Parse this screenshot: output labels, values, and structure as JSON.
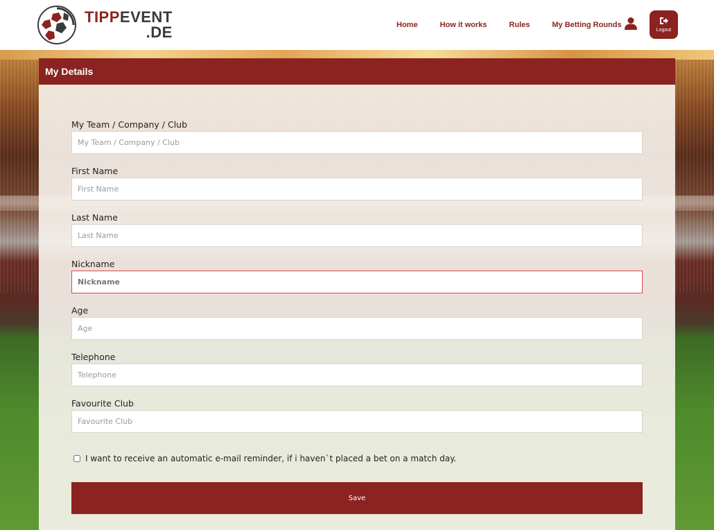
{
  "brand": {
    "logo_part1": "TIPP",
    "logo_part2": "EVENT",
    "logo_line2": ".DE",
    "primary_color": "#8b2320"
  },
  "nav": {
    "items": [
      {
        "label": "Home"
      },
      {
        "label": "How it works"
      },
      {
        "label": "Rules"
      },
      {
        "label": "My Betting Rounds"
      }
    ],
    "user_icon": "user-icon",
    "logout_label": "Logout",
    "logout_icon": "logout-icon"
  },
  "panel": {
    "title": "My Details"
  },
  "form": {
    "fields": [
      {
        "label": "My Team / Company / Club",
        "placeholder": "My Team / Company / Club",
        "value": ""
      },
      {
        "label": "First Name",
        "placeholder": "First Name",
        "value": ""
      },
      {
        "label": "Last Name",
        "placeholder": "Last Name",
        "value": ""
      },
      {
        "label": "Nickname",
        "placeholder": "Nickname",
        "value": "",
        "invalid": true
      },
      {
        "label": "Age",
        "placeholder": "Age",
        "value": ""
      },
      {
        "label": "Telephone",
        "placeholder": "Telephone",
        "value": ""
      },
      {
        "label": "Favourite Club",
        "placeholder": "Favourite Club",
        "value": ""
      }
    ],
    "reminder_label": "I want to receive an automatic e-mail reminder, if i haven`t placed a bet on a match day.",
    "reminder_checked": false,
    "save_label": "Save"
  }
}
